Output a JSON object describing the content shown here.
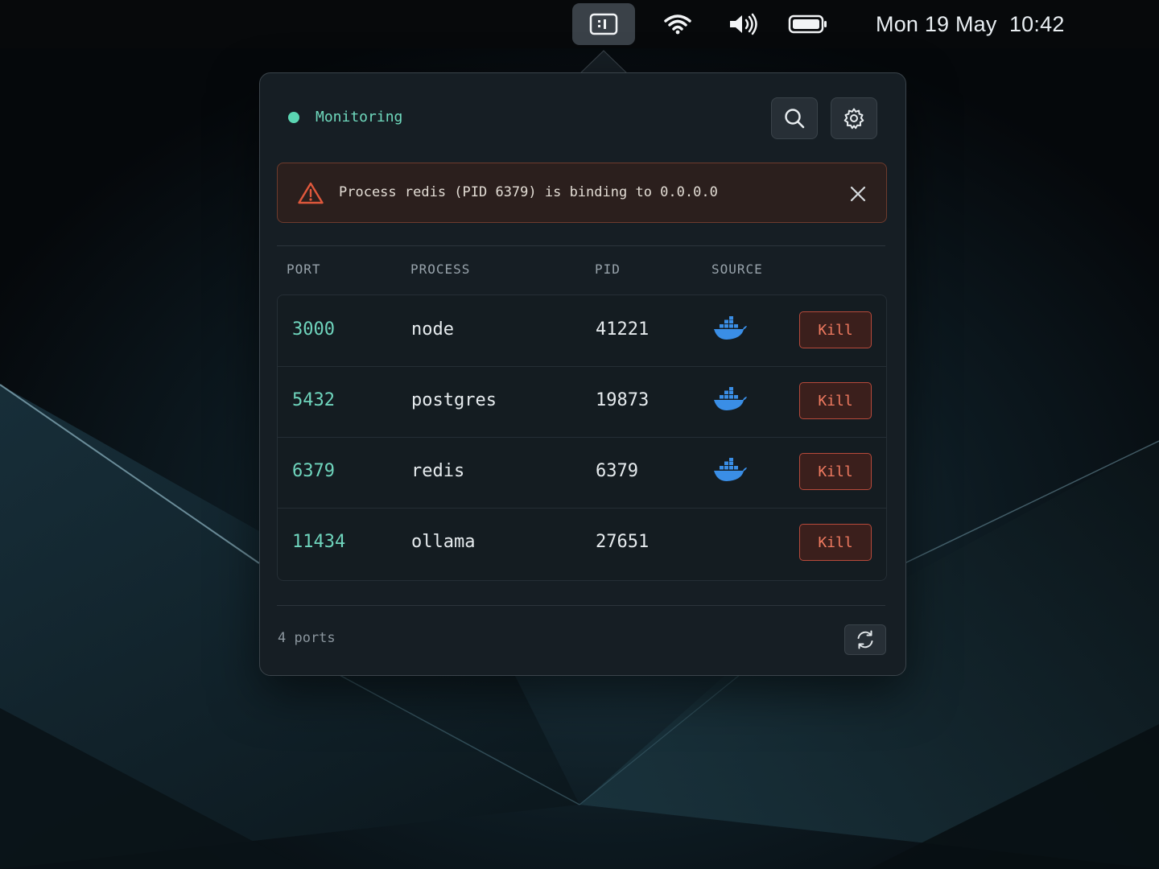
{
  "menubar": {
    "app_icon": "port-monitor-icon",
    "status_icons": [
      "wifi-icon",
      "volume-icon",
      "battery-icon"
    ],
    "clock": "Mon 19 May  10:42"
  },
  "popover": {
    "status_label": "Monitoring",
    "status_color": "#5bd6b3",
    "alert": {
      "icon": "warning-icon",
      "message": "Process redis (PID 6379) is binding to 0.0.0.0",
      "accent": "#e0583c"
    },
    "table": {
      "headers": {
        "port": "PORT",
        "process": "PROCESS",
        "pid": "PID",
        "source": "SOURCE"
      },
      "rows": [
        {
          "port": "3000",
          "process": "node",
          "pid": "41221",
          "source": "docker-icon",
          "action": "Kill"
        },
        {
          "port": "5432",
          "process": "postgres",
          "pid": "19873",
          "source": "docker-icon",
          "action": "Kill"
        },
        {
          "port": "6379",
          "process": "redis",
          "pid": "6379",
          "source": "docker-icon",
          "action": "Kill"
        },
        {
          "port": "11434",
          "process": "ollama",
          "pid": "27651",
          "source": "",
          "action": "Kill"
        }
      ]
    },
    "footer": {
      "count_label": "4 ports"
    }
  }
}
